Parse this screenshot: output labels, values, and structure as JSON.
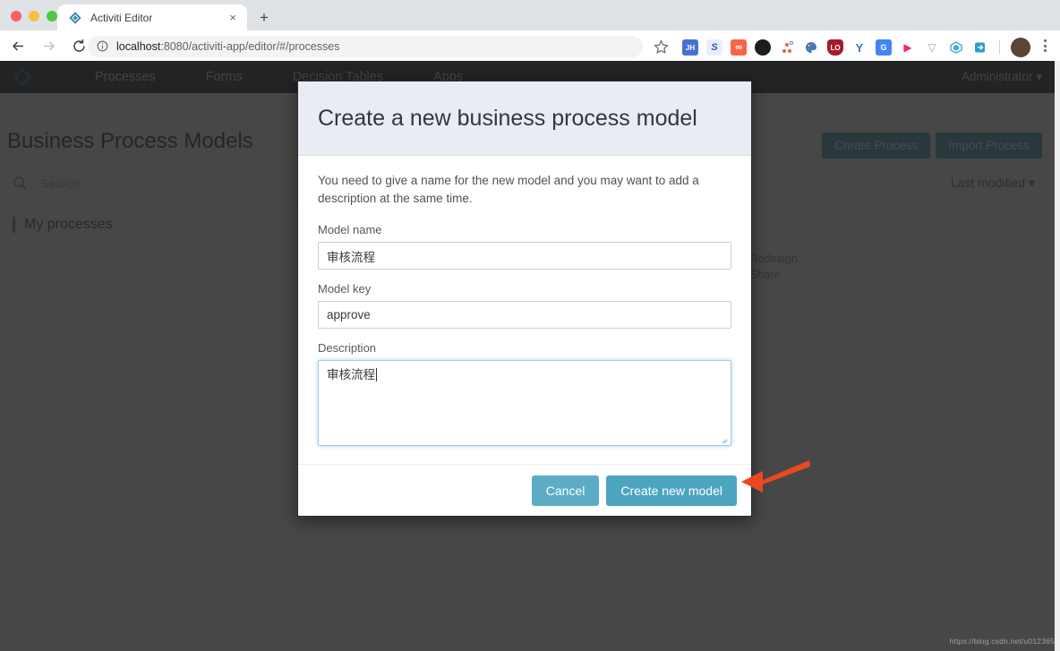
{
  "browser": {
    "tab": {
      "title": "Activiti Editor",
      "favicon_icon": "activiti-diamond-icon",
      "close_icon": "×"
    },
    "new_tab_label": "+",
    "back_icon": "←",
    "forward_icon": "→",
    "reload_icon": "⟳",
    "omnibox": {
      "info_icon": "ⓘ",
      "host": "localhost",
      "path": ":8080/activiti-app/editor/#/processes",
      "full_url": "localhost:8080/activiti-app/editor/#/processes"
    },
    "bookmark_icon": "☆",
    "menu_icon": "kebab-menu-icon",
    "extensions": [
      {
        "name": "jupyterhub-extension-icon",
        "label": "JH",
        "color": "#4a6fd4"
      },
      {
        "name": "s-extension-icon",
        "label": "S",
        "color": "#e8eefc"
      },
      {
        "name": "infinity-extension-icon",
        "label": "∞",
        "color": "#f4664a"
      },
      {
        "name": "panda-extension-icon",
        "label": "",
        "color": "#1c1c1c"
      },
      {
        "name": "sitemap-extension-icon",
        "label": "",
        "color": "#ffffff"
      },
      {
        "name": "palette-extension-icon",
        "label": "",
        "color": "#f2c14e"
      },
      {
        "name": "lastpass-extension-icon",
        "label": "LO",
        "color": "#a8192b"
      },
      {
        "name": "y-extension-icon",
        "label": "Y",
        "color": "#3b72c4"
      },
      {
        "name": "google-translate-extension-icon",
        "label": "G",
        "color": "#4285f4"
      },
      {
        "name": "play-extension-icon",
        "label": "▶",
        "color": "#f4256a"
      },
      {
        "name": "v-outline-extension-icon",
        "label": "V",
        "color": "#ffffff"
      },
      {
        "name": "cube-extension-icon",
        "label": "",
        "color": "#3fa9d8"
      },
      {
        "name": "save-page-extension-icon",
        "label": "",
        "color": "#2f9ec4"
      }
    ],
    "profile_name": "profile-avatar"
  },
  "app": {
    "logo_icon": "activiti-logo-icon",
    "nav_items": [
      {
        "label": "Processes",
        "active": true
      },
      {
        "label": "Forms",
        "active": false
      },
      {
        "label": "Decision Tables",
        "active": false
      },
      {
        "label": "Apps",
        "active": false
      }
    ],
    "user_menu": "Administrator ▾",
    "page_title": "Business Process Models",
    "header_actions": [
      {
        "label": "Create Process"
      },
      {
        "label": "Import Process"
      }
    ],
    "search": {
      "icon": "search-icon",
      "placeholder": "Search"
    },
    "sort_control": "Last modified ▾",
    "section_label": "My processes",
    "card_links": [
      "Redesign",
      "Share"
    ]
  },
  "modal": {
    "title": "Create a new business process model",
    "intro": "You need to give a name for the new model and you may want to add a description at the same time.",
    "fields": {
      "model_name": {
        "label": "Model name",
        "value": "审核流程",
        "placeholder": ""
      },
      "model_key": {
        "label": "Model key",
        "value": "approve",
        "placeholder": ""
      },
      "description": {
        "label": "Description",
        "value": "审核流程",
        "placeholder": "",
        "focused": true
      }
    },
    "buttons": {
      "cancel": "Cancel",
      "create": "Create new model"
    },
    "accent_color": "#5bacc4",
    "header_bg": "#e9edf3"
  },
  "annotation": {
    "arrow": {
      "name": "red-arrow-pointer",
      "color": "#e8491f",
      "points_to": "Create new model"
    }
  },
  "watermark": "https://blog.csdn.net/u012365"
}
